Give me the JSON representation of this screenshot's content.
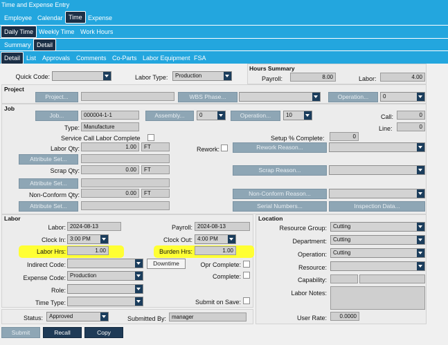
{
  "window_title": "Time and Expense Entry",
  "top_tabs": [
    "Employee",
    "Calendar",
    "Time",
    "Expense"
  ],
  "sub_tabs": [
    "Daily Time",
    "Weekly Time",
    "Work Hours"
  ],
  "view_tabs": [
    "Summary",
    "Detail"
  ],
  "detail_tabs": [
    "Detail",
    "List",
    "Approvals",
    "Comments",
    "Co-Parts",
    "Labor Equipment",
    "FSA"
  ],
  "hours_summary": {
    "title": "Hours Summary",
    "payroll_label": "Payroll:",
    "payroll": "8.00",
    "labor_label": "Labor:",
    "labor": "4.00"
  },
  "header": {
    "quick_code_label": "Quick Code:",
    "quick_code": "",
    "labor_type_label": "Labor Type:",
    "labor_type": "Production"
  },
  "project": {
    "title": "Project",
    "project_btn": "Project...",
    "project_val": "",
    "wbs_btn": "WBS Phase...",
    "wbs_val": "",
    "operation_btn": "Operation...",
    "operation_val": "0"
  },
  "job": {
    "title": "Job",
    "job_btn": "Job...",
    "job_val": "000004-1-1",
    "assembly_btn": "Assembly...",
    "assembly_val": "0",
    "operation_btn": "Operation...",
    "operation_val": "10",
    "call_label": "Call:",
    "call_val": "0",
    "line_label": "Line:",
    "line_val": "0",
    "type_label": "Type:",
    "type_val": "Manufacture",
    "service_call_label": "Service Call Labor Complete",
    "setup_label": "Setup % Complete:",
    "setup_val": "0",
    "labor_qty_label": "Labor Qty:",
    "labor_qty": "1.00",
    "labor_uom": "FT",
    "rework_label": "Rework:",
    "rework_reason_btn": "Rework Reason...",
    "rework_reason_val": "",
    "attr_btn": "Attribute Set...",
    "scrap_qty_label": "Scrap Qty:",
    "scrap_qty": "0.00",
    "scrap_uom": "FT",
    "scrap_reason_btn": "Scrap Reason...",
    "scrap_reason_val": "",
    "nonconf_qty_label": "Non-Conform Qty:",
    "nonconf_qty": "0.00",
    "nonconf_uom": "FT",
    "nonconf_reason_btn": "Non-Conform Reason...",
    "nonconf_reason_val": "",
    "serial_btn": "Serial Numbers...",
    "inspection_btn": "Inspection Data..."
  },
  "labor": {
    "title": "Labor",
    "labor_label": "Labor:",
    "labor_date": "2024-08-13",
    "payroll_label": "Payroll:",
    "payroll_date": "2024-08-13",
    "clock_in_label": "Clock In:",
    "clock_in": "3:00 PM",
    "clock_out_label": "Clock Out:",
    "clock_out": "4:00 PM",
    "labor_hrs_label": "Labor Hrs:",
    "labor_hrs": "1.00",
    "burden_hrs_label": "Burden Hrs:",
    "burden_hrs": "1.00",
    "indirect_label": "Indirect Code:",
    "indirect_val": "",
    "downtime_btn": "Downtime",
    "opr_complete_label": "Opr Complete:",
    "expense_label": "Expense Code:",
    "expense_val": "Production",
    "complete_label": "Complete:",
    "role_label": "Role:",
    "role_val": "",
    "time_type_label": "Time Type:",
    "time_type_val": "",
    "submit_on_save_label": "Submit on Save:"
  },
  "location": {
    "title": "Location",
    "resource_group_label": "Resource Group:",
    "resource_group": "Cutting",
    "department_label": "Department:",
    "department": "Cutting",
    "operation_label": "Operation:",
    "operation": "Cutting",
    "resource_label": "Resource:",
    "resource": "",
    "capability_label": "Capability:",
    "capability": "",
    "labor_notes_label": "Labor Notes:",
    "labor_notes": "",
    "user_rate_label": "User Rate:",
    "user_rate": "0.0000"
  },
  "status": {
    "status_label": "Status:",
    "status_val": "Approved",
    "submitted_by_label": "Submitted By:",
    "submitted_by": "manager"
  },
  "actions": {
    "submit": "Submit",
    "recall": "Recall",
    "copy": "Copy"
  },
  "colors": {
    "nav_blue": "#23a6de",
    "active_tab": "#1b2f46",
    "highlight": "#ffff33",
    "disabled_button": "#8ea6b5"
  }
}
